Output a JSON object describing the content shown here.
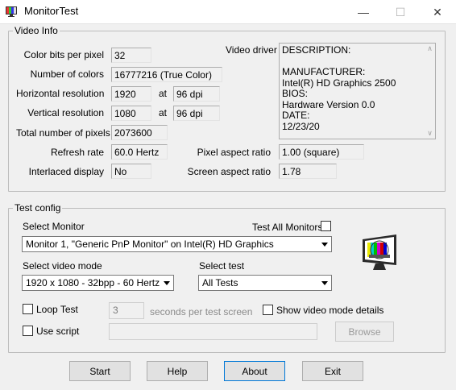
{
  "window": {
    "title": "MonitorTest",
    "minimize_glyph": "—",
    "maximize_glyph": "☐",
    "close_glyph": "✕"
  },
  "video_info": {
    "group_label": "Video Info",
    "color_bits_label": "Color bits per pixel",
    "color_bits_value": "32",
    "num_colors_label": "Number of colors",
    "num_colors_value": "16777216 (True Color)",
    "h_res_label": "Horizontal resolution",
    "h_res_value": "1920",
    "h_at": "at",
    "h_dpi": "96 dpi",
    "v_res_label": "Vertical resolution",
    "v_res_value": "1080",
    "v_at": "at",
    "v_dpi": "96 dpi",
    "total_pixels_label": "Total number of pixels",
    "total_pixels_value": "2073600",
    "refresh_label": "Refresh rate",
    "refresh_value": "60.0 Hertz",
    "interlaced_label": "Interlaced display",
    "interlaced_value": "No",
    "video_driver_label": "Video driver",
    "video_driver_lines": [
      "DESCRIPTION:",
      "",
      "MANUFACTURER:",
      "Intel(R) HD Graphics 2500",
      "BIOS:",
      "Hardware Version 0.0",
      "DATE:",
      "12/23/20"
    ],
    "pixel_aspect_label": "Pixel aspect ratio",
    "pixel_aspect_value": "1.00 (square)",
    "screen_aspect_label": "Screen aspect ratio",
    "screen_aspect_value": "1.78"
  },
  "test_config": {
    "group_label": "Test config",
    "select_monitor_label": "Select Monitor",
    "test_all_monitors_label": "Test All Monitors",
    "monitor_selected": "Monitor 1, \"Generic PnP Monitor\" on Intel(R) HD Graphics",
    "select_video_mode_label": "Select video mode",
    "video_mode_selected": "1920 x 1080 - 32bpp - 60 Hertz",
    "select_test_label": "Select test",
    "test_selected": "All Tests",
    "loop_test_label": "Loop Test",
    "loop_seconds_value": "3",
    "seconds_label": "seconds per test screen",
    "show_details_label": "Show video mode details",
    "use_script_label": "Use script",
    "script_path_value": "",
    "browse_label": "Browse"
  },
  "buttons": {
    "start": "Start",
    "help": "Help",
    "about": "About",
    "exit": "Exit"
  },
  "icons": {
    "app": "monitor-test-icon",
    "test_pattern": "test-pattern-monitor-icon"
  }
}
